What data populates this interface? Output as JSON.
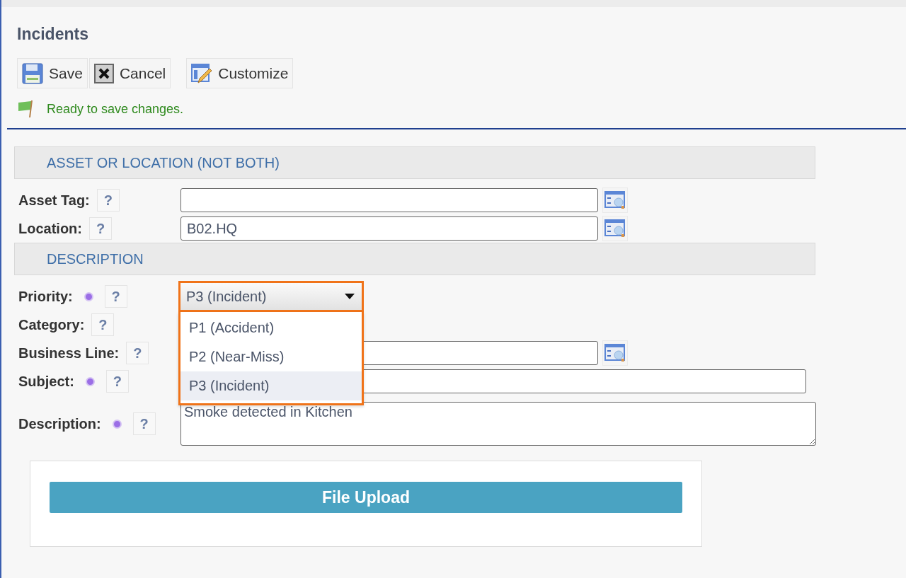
{
  "page": {
    "title": "Incidents"
  },
  "toolbar": [
    {
      "kind": "save",
      "label": "Save"
    },
    {
      "kind": "cancel",
      "label": "Cancel"
    },
    {
      "kind": "customize",
      "label": "Customize"
    }
  ],
  "status": {
    "message": "Ready to save changes."
  },
  "sections": [
    {
      "title": "ASSET OR LOCATION (NOT BOTH)",
      "fields": [
        {
          "label": "Asset Tag:",
          "required": false,
          "help": "?",
          "kind": "lookup"
        },
        {
          "label": "Location:",
          "required": false,
          "help": "?",
          "kind": "lookup",
          "value": "B02.HQ"
        }
      ]
    },
    {
      "title": "DESCRIPTION",
      "fields": [
        {
          "label": "Priority:",
          "required": true,
          "help": "?",
          "kind": "select",
          "value": "P3 (Incident)",
          "open": true,
          "options": [
            {
              "label": "P1 (Accident)",
              "selected": false
            },
            {
              "label": "P2 (Near-Miss)",
              "selected": false
            },
            {
              "label": "P3 (Incident)",
              "selected": true
            }
          ]
        },
        {
          "label": "Category:",
          "required": false,
          "help": "?",
          "kind": "hidden"
        },
        {
          "label": "Business Line:",
          "required": false,
          "help": "?",
          "kind": "lookup"
        },
        {
          "label": "Subject:",
          "required": true,
          "help": "?",
          "kind": "text"
        },
        {
          "label": "Description:",
          "required": true,
          "help": "?",
          "kind": "textarea",
          "value": "Smoke detected in Kitchen"
        }
      ]
    }
  ],
  "upload": {
    "button": "File Upload"
  }
}
